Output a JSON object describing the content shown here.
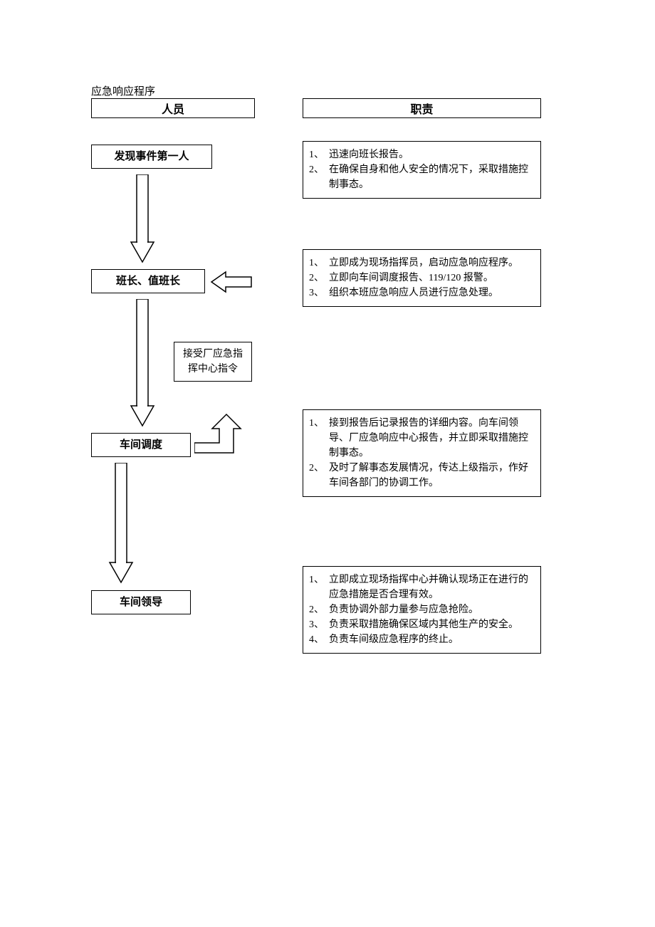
{
  "title": "应急响应程序",
  "headers": {
    "left": "人员",
    "right": "职责"
  },
  "nodes": {
    "n1": "发现事件第一人",
    "n2": "班长、值班长",
    "n3": "车间调度",
    "n4": "车间领导",
    "side": "接受厂应急指挥中心指令"
  },
  "duties": {
    "d1": [
      "迅速向班长报告。",
      "在确保自身和他人安全的情况下，采取措施控制事态。"
    ],
    "d2": [
      "立即成为现场指挥员，启动应急响应程序。",
      "立即向车间调度报告、119/120 报警。",
      "组织本班应急响应人员进行应急处理。"
    ],
    "d3": [
      "接到报告后记录报告的详细内容。向车间领导、厂应急响应中心报告，并立即采取措施控制事态。",
      "及时了解事态发展情况，传达上级指示，作好车间各部门的协调工作。"
    ],
    "d4": [
      "立即成立现场指挥中心并确认现场正在进行的应急措施是否合理有效。",
      "负责协调外部力量参与应急抢险。",
      "负责采取措施确保区域内其他生产的安全。",
      "负责车间级应急程序的终止。"
    ]
  }
}
